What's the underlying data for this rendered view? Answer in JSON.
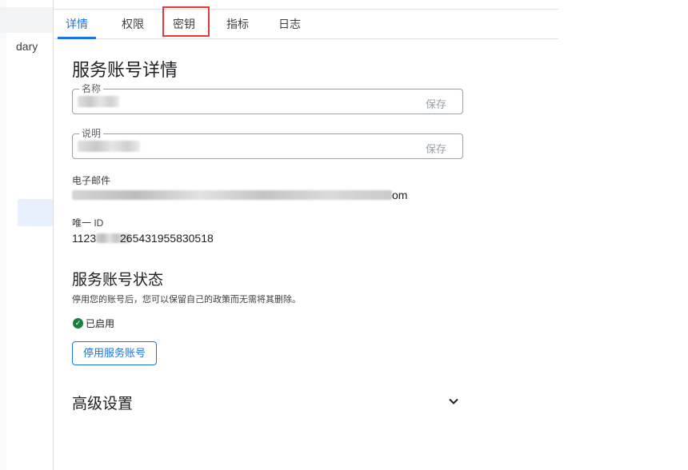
{
  "sidebar": {
    "partial_item_text": "dary"
  },
  "tabs": [
    {
      "label": "详情",
      "active": true
    },
    {
      "label": "权限",
      "active": false
    },
    {
      "label": "密钥",
      "active": false,
      "highlighted": true
    },
    {
      "label": "指标",
      "active": false
    },
    {
      "label": "日志",
      "active": false
    }
  ],
  "details": {
    "title": "服务账号详情",
    "name_field": {
      "legend": "名称",
      "save_label": "保存"
    },
    "desc_field": {
      "legend": "说明",
      "save_label": "保存"
    },
    "email_label": "电子邮件",
    "email_visible_suffix": "om",
    "unique_id_label": "唯一 ID",
    "unique_id_prefix": "1123",
    "unique_id_suffix": "265431955830518"
  },
  "status_section": {
    "title": "服务账号状态",
    "description": "停用您的账号后，您可以保留自己的政策而无需将其删除。",
    "status_text": "已启用",
    "disable_button": "停用服务账号"
  },
  "advanced": {
    "title": "高级设置"
  },
  "colors": {
    "accent": "#1a73e8",
    "highlight_border": "#e53935",
    "status_green": "#188038"
  }
}
